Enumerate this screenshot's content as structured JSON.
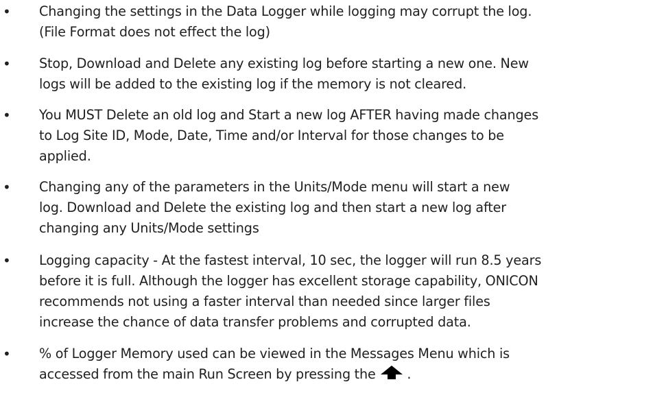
{
  "notes": [
    {
      "text": "Changing the settings in the Data Logger while logging may corrupt the log.\n(File Format does not effect the log)"
    },
    {
      "text": "Stop, Download and Delete any existing log before starting a new one.  New\nlogs will be added to the existing log if the memory is not cleared."
    },
    {
      "text": "You MUST Delete an old log and Start a new log AFTER having made changes\nto Log Site ID, Mode, Date, Time and/or Interval for those changes to be\napplied."
    },
    {
      "text": "Changing any of the parameters in the Units/Mode menu will start a new\nlog. Download and Delete the existing log and then start a new log after\nchanging any Units/Mode settings"
    },
    {
      "text": "Logging capacity - At the fastest interval, 10 sec, the logger will run 8.5 years\nbefore it is full. Although the logger has excellent storage capability, ONICON\nrecommends not using a faster interval than needed since larger files\nincrease the chance of data transfer problems and corrupted data."
    },
    {
      "text_line1": "% of Logger Memory used can be viewed in the Messages Menu which is",
      "text_line2": "accessed from the main Run Screen by pressing the",
      "text_after_icon": ".",
      "icon": "up-arrow-icon"
    }
  ],
  "bullet": "•",
  "colors": {
    "text": "#1f1f1f",
    "icon": "#000000"
  }
}
